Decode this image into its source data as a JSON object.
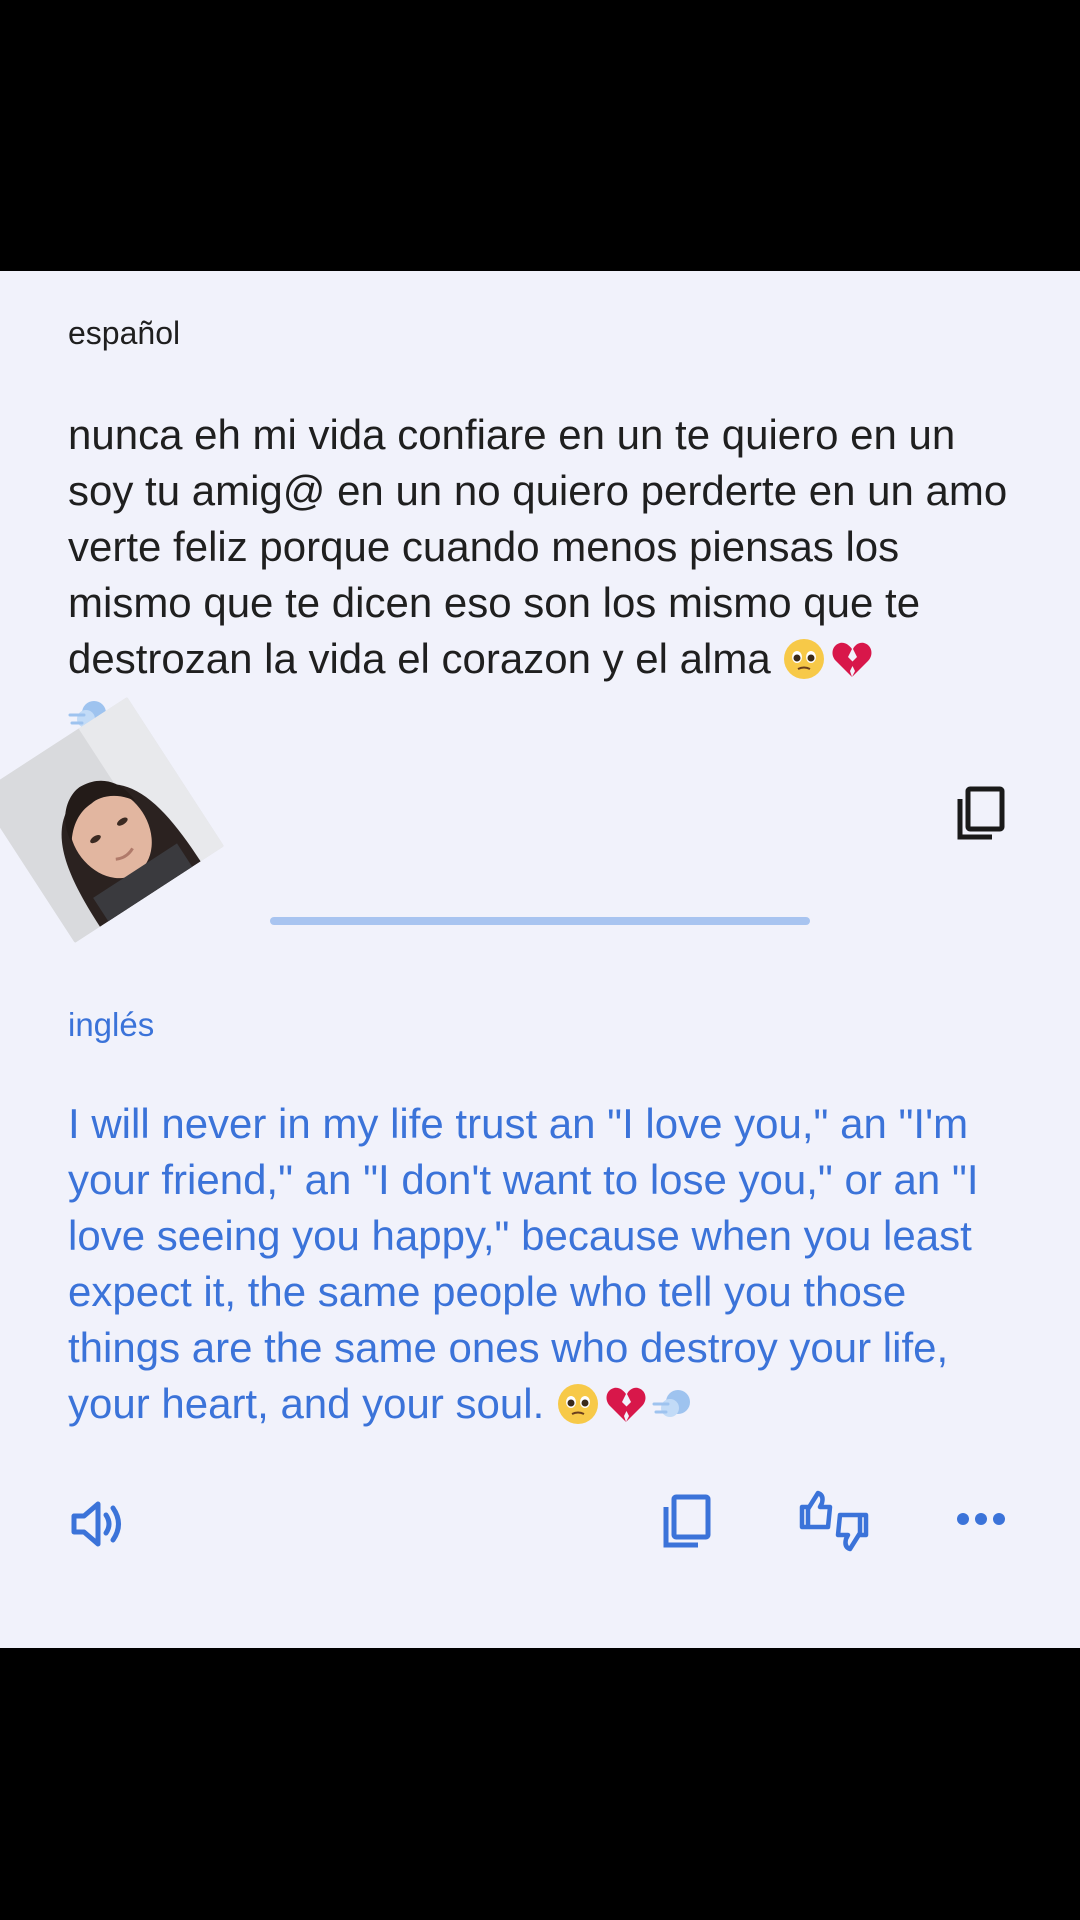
{
  "source": {
    "language": "español",
    "text": "nunca eh mi vida confiare en un te quiero en un soy tu amig@ en un no quiero perderte en un amo verte feliz porque cuando menos piensas los mismo que te dicen eso son los mismo que te destrozan la vida el corazon y el alma",
    "copy_icon": "copy-icon"
  },
  "translation": {
    "language": "inglés",
    "text": "I will never in my life trust an \"I love you,\" an \"I'm your friend,\" an \"I don't want to lose you,\" or an \"I love seeing you happy,\" because when you least expect it, the same people who tell you those things are the same ones who destroy your life, your heart, and your soul.",
    "actions": [
      "speaker-icon",
      "copy-icon",
      "feedback-icon",
      "more-icon"
    ]
  },
  "emojis": [
    "pleading-face",
    "broken-heart",
    "dash-symbol"
  ],
  "colors": {
    "card_bg": "#f1f2fb",
    "source_text": "#1f1f1f",
    "translation_text": "#3b73d9",
    "divider": "#a8c4f0"
  }
}
